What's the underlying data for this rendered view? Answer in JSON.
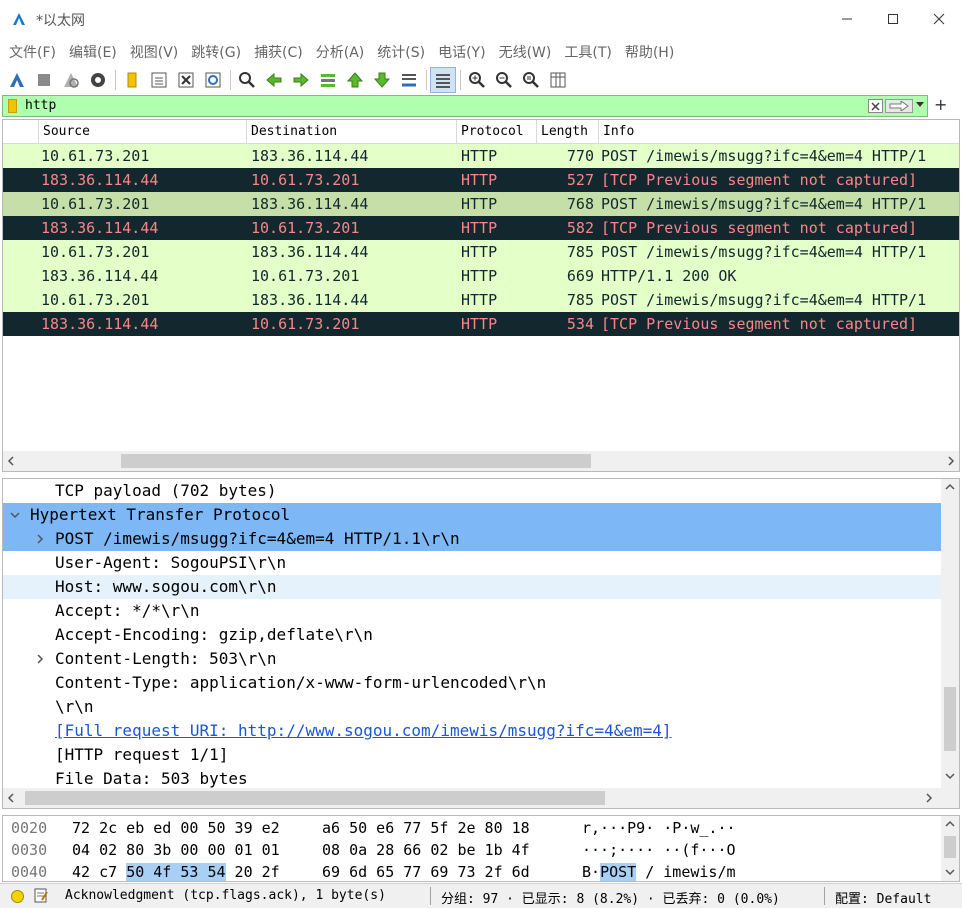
{
  "window": {
    "title": "*以太网",
    "minimize_glyph": "minimize-icon",
    "maximize_glyph": "maximize-icon",
    "close_glyph": "close-icon"
  },
  "menu": [
    "文件(F)",
    "编辑(E)",
    "视图(V)",
    "跳转(G)",
    "捕获(C)",
    "分析(A)",
    "统计(S)",
    "电话(Y)",
    "无线(W)",
    "工具(T)",
    "帮助(H)"
  ],
  "toolbar": {
    "icons": [
      "start-capture-icon",
      "stop-capture-icon",
      "restart-capture-icon",
      "capture-options-icon",
      "open-file-icon",
      "save-file-icon",
      "close-file-icon",
      "reload-file-icon",
      "find-packet-icon",
      "go-back-icon",
      "go-forward-icon",
      "go-to-packet-icon",
      "first-packet-icon",
      "last-packet-icon",
      "auto-scroll-icon",
      "colorize-icon",
      "zoom-in-icon",
      "zoom-out-icon",
      "normal-size-icon",
      "resize-columns-icon"
    ]
  },
  "filter": {
    "value": "http",
    "add_label": "+"
  },
  "packet_list": {
    "columns": [
      "Source",
      "Destination",
      "Protocol",
      "Length",
      "Info"
    ],
    "rows": [
      {
        "source": "10.61.73.201",
        "destination": "183.36.114.44",
        "protocol": "HTTP",
        "length": "770",
        "info": "POST /imewis/msugg?ifc=4&em=4 HTTP/1",
        "style": "green"
      },
      {
        "source": "183.36.114.44",
        "destination": "10.61.73.201",
        "protocol": "HTTP",
        "length": "527",
        "info": "[TCP Previous segment not captured]",
        "style": "dark"
      },
      {
        "source": "10.61.73.201",
        "destination": "183.36.114.44",
        "protocol": "HTTP",
        "length": "768",
        "info": "POST /imewis/msugg?ifc=4&em=4 HTTP/1",
        "style": "green-sel"
      },
      {
        "source": "183.36.114.44",
        "destination": "10.61.73.201",
        "protocol": "HTTP",
        "length": "582",
        "info": "[TCP Previous segment not captured]",
        "style": "dark"
      },
      {
        "source": "10.61.73.201",
        "destination": "183.36.114.44",
        "protocol": "HTTP",
        "length": "785",
        "info": "POST /imewis/msugg?ifc=4&em=4 HTTP/1",
        "style": "green"
      },
      {
        "source": "183.36.114.44",
        "destination": "10.61.73.201",
        "protocol": "HTTP",
        "length": "669",
        "info": "HTTP/1.1 200 OK",
        "style": "green"
      },
      {
        "source": "10.61.73.201",
        "destination": "183.36.114.44",
        "protocol": "HTTP",
        "length": "785",
        "info": "POST /imewis/msugg?ifc=4&em=4 HTTP/1",
        "style": "green"
      },
      {
        "source": "183.36.114.44",
        "destination": "10.61.73.201",
        "protocol": "HTTP",
        "length": "534",
        "info": "[TCP Previous segment not captured]",
        "style": "dark"
      }
    ]
  },
  "details": {
    "rows": [
      {
        "text": "TCP payload (702 bytes)",
        "indent": 1,
        "arrow": "",
        "state": ""
      },
      {
        "text": "Hypertext Transfer Protocol",
        "indent": 0,
        "arrow": "down",
        "state": "sel"
      },
      {
        "text": "POST /imewis/msugg?ifc=4&em=4 HTTP/1.1\\r\\n",
        "indent": 1,
        "arrow": "right",
        "state": "sel"
      },
      {
        "text": "User-Agent: SogouPSI\\r\\n",
        "indent": 1,
        "arrow": "",
        "state": ""
      },
      {
        "text": "Host: www.sogou.com\\r\\n",
        "indent": 1,
        "arrow": "",
        "state": "hover"
      },
      {
        "text": "Accept: */*\\r\\n",
        "indent": 1,
        "arrow": "",
        "state": ""
      },
      {
        "text": "Accept-Encoding: gzip,deflate\\r\\n",
        "indent": 1,
        "arrow": "",
        "state": ""
      },
      {
        "text": "Content-Length: 503\\r\\n",
        "indent": 1,
        "arrow": "right",
        "state": ""
      },
      {
        "text": "Content-Type: application/x-www-form-urlencoded\\r\\n",
        "indent": 1,
        "arrow": "",
        "state": ""
      },
      {
        "text": "\\r\\n",
        "indent": 1,
        "arrow": "",
        "state": ""
      },
      {
        "text": "[Full request URI: http://www.sogou.com/imewis/msugg?ifc=4&em=4]",
        "indent": 1,
        "arrow": "",
        "state": "link"
      },
      {
        "text": "[HTTP request 1/1]",
        "indent": 1,
        "arrow": "",
        "state": ""
      },
      {
        "text": "File Data: 503 bytes",
        "indent": 1,
        "arrow": "",
        "state": ""
      }
    ]
  },
  "bytes": {
    "rows": [
      {
        "offset": "0020",
        "hex1": "72 2c eb ed 00 50 39 e2",
        "hex2": "a6 50 e6 77 5f 2e 80 18",
        "ascii": "r,···P9· ·P·w_.··"
      },
      {
        "offset": "0030",
        "hex1": "04 02 80 3b 00 00 01 01",
        "hex2": "08 0a 28 66 02 be 1b 4f",
        "ascii": "···;···· ··(f···O"
      },
      {
        "offset": "0040",
        "hex1": "42 c7 ",
        "hex1_hl": "50 4f 53 54",
        "hex1_tail": " 20 2f",
        "hex2": "69 6d 65 77 69 73 2f 6d",
        "ascii_pre": "B·",
        "ascii_hl": "POST",
        "ascii_post": " / imewis/m"
      }
    ]
  },
  "status": {
    "field": "Acknowledgment (tcp.flags.ack), 1 byte(s)",
    "packets": "分组: 97 · 已显示: 8 (8.2%) · 已丢弃: 0 (0.0%)",
    "profile": "配置: Default"
  },
  "colors": {
    "filter_ok": "#afffaf",
    "row_green": "#e4ffc7",
    "row_dark": "#12272e",
    "row_dark_text": "#f78787",
    "tree_selected": "#7eb7f5"
  }
}
